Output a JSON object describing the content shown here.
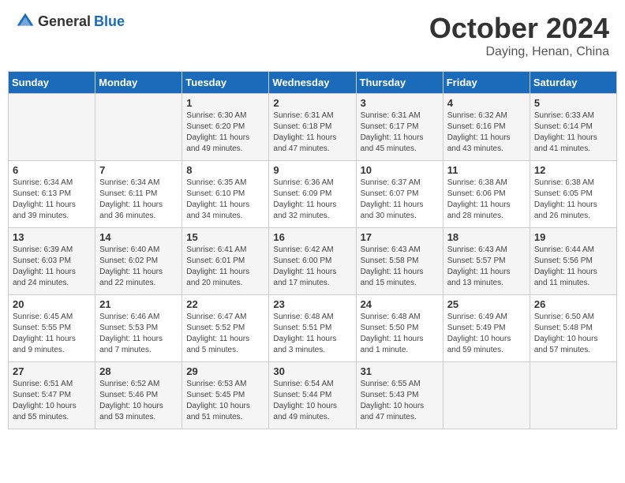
{
  "logo": {
    "general": "General",
    "blue": "Blue"
  },
  "title": "October 2024",
  "subtitle": "Daying, Henan, China",
  "weekdays": [
    "Sunday",
    "Monday",
    "Tuesday",
    "Wednesday",
    "Thursday",
    "Friday",
    "Saturday"
  ],
  "weeks": [
    [
      {
        "day": "",
        "info": ""
      },
      {
        "day": "",
        "info": ""
      },
      {
        "day": "1",
        "info": "Sunrise: 6:30 AM\nSunset: 6:20 PM\nDaylight: 11 hours and 49 minutes."
      },
      {
        "day": "2",
        "info": "Sunrise: 6:31 AM\nSunset: 6:18 PM\nDaylight: 11 hours and 47 minutes."
      },
      {
        "day": "3",
        "info": "Sunrise: 6:31 AM\nSunset: 6:17 PM\nDaylight: 11 hours and 45 minutes."
      },
      {
        "day": "4",
        "info": "Sunrise: 6:32 AM\nSunset: 6:16 PM\nDaylight: 11 hours and 43 minutes."
      },
      {
        "day": "5",
        "info": "Sunrise: 6:33 AM\nSunset: 6:14 PM\nDaylight: 11 hours and 41 minutes."
      }
    ],
    [
      {
        "day": "6",
        "info": "Sunrise: 6:34 AM\nSunset: 6:13 PM\nDaylight: 11 hours and 39 minutes."
      },
      {
        "day": "7",
        "info": "Sunrise: 6:34 AM\nSunset: 6:11 PM\nDaylight: 11 hours and 36 minutes."
      },
      {
        "day": "8",
        "info": "Sunrise: 6:35 AM\nSunset: 6:10 PM\nDaylight: 11 hours and 34 minutes."
      },
      {
        "day": "9",
        "info": "Sunrise: 6:36 AM\nSunset: 6:09 PM\nDaylight: 11 hours and 32 minutes."
      },
      {
        "day": "10",
        "info": "Sunrise: 6:37 AM\nSunset: 6:07 PM\nDaylight: 11 hours and 30 minutes."
      },
      {
        "day": "11",
        "info": "Sunrise: 6:38 AM\nSunset: 6:06 PM\nDaylight: 11 hours and 28 minutes."
      },
      {
        "day": "12",
        "info": "Sunrise: 6:38 AM\nSunset: 6:05 PM\nDaylight: 11 hours and 26 minutes."
      }
    ],
    [
      {
        "day": "13",
        "info": "Sunrise: 6:39 AM\nSunset: 6:03 PM\nDaylight: 11 hours and 24 minutes."
      },
      {
        "day": "14",
        "info": "Sunrise: 6:40 AM\nSunset: 6:02 PM\nDaylight: 11 hours and 22 minutes."
      },
      {
        "day": "15",
        "info": "Sunrise: 6:41 AM\nSunset: 6:01 PM\nDaylight: 11 hours and 20 minutes."
      },
      {
        "day": "16",
        "info": "Sunrise: 6:42 AM\nSunset: 6:00 PM\nDaylight: 11 hours and 17 minutes."
      },
      {
        "day": "17",
        "info": "Sunrise: 6:43 AM\nSunset: 5:58 PM\nDaylight: 11 hours and 15 minutes."
      },
      {
        "day": "18",
        "info": "Sunrise: 6:43 AM\nSunset: 5:57 PM\nDaylight: 11 hours and 13 minutes."
      },
      {
        "day": "19",
        "info": "Sunrise: 6:44 AM\nSunset: 5:56 PM\nDaylight: 11 hours and 11 minutes."
      }
    ],
    [
      {
        "day": "20",
        "info": "Sunrise: 6:45 AM\nSunset: 5:55 PM\nDaylight: 11 hours and 9 minutes."
      },
      {
        "day": "21",
        "info": "Sunrise: 6:46 AM\nSunset: 5:53 PM\nDaylight: 11 hours and 7 minutes."
      },
      {
        "day": "22",
        "info": "Sunrise: 6:47 AM\nSunset: 5:52 PM\nDaylight: 11 hours and 5 minutes."
      },
      {
        "day": "23",
        "info": "Sunrise: 6:48 AM\nSunset: 5:51 PM\nDaylight: 11 hours and 3 minutes."
      },
      {
        "day": "24",
        "info": "Sunrise: 6:48 AM\nSunset: 5:50 PM\nDaylight: 11 hours and 1 minute."
      },
      {
        "day": "25",
        "info": "Sunrise: 6:49 AM\nSunset: 5:49 PM\nDaylight: 10 hours and 59 minutes."
      },
      {
        "day": "26",
        "info": "Sunrise: 6:50 AM\nSunset: 5:48 PM\nDaylight: 10 hours and 57 minutes."
      }
    ],
    [
      {
        "day": "27",
        "info": "Sunrise: 6:51 AM\nSunset: 5:47 PM\nDaylight: 10 hours and 55 minutes."
      },
      {
        "day": "28",
        "info": "Sunrise: 6:52 AM\nSunset: 5:46 PM\nDaylight: 10 hours and 53 minutes."
      },
      {
        "day": "29",
        "info": "Sunrise: 6:53 AM\nSunset: 5:45 PM\nDaylight: 10 hours and 51 minutes."
      },
      {
        "day": "30",
        "info": "Sunrise: 6:54 AM\nSunset: 5:44 PM\nDaylight: 10 hours and 49 minutes."
      },
      {
        "day": "31",
        "info": "Sunrise: 6:55 AM\nSunset: 5:43 PM\nDaylight: 10 hours and 47 minutes."
      },
      {
        "day": "",
        "info": ""
      },
      {
        "day": "",
        "info": ""
      }
    ]
  ]
}
